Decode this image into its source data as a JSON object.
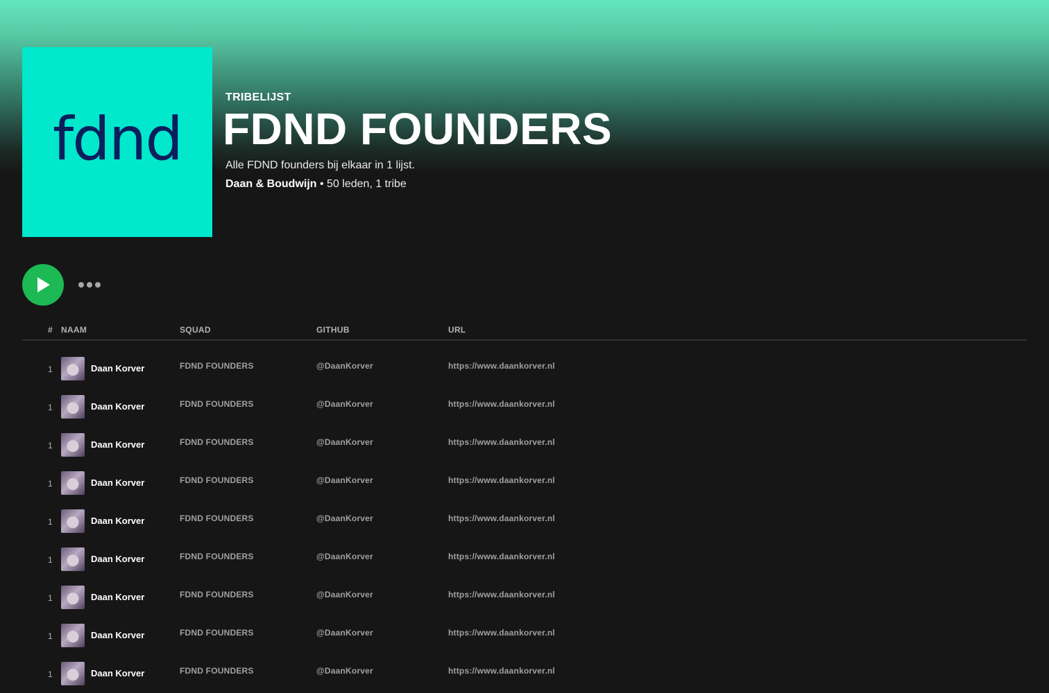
{
  "hero": {
    "cover_text": "fdnd",
    "type_label": "TRIBELIJST",
    "title": "FDND FOUNDERS",
    "description": "Alle FDND founders bij elkaar in 1 lijst.",
    "owner": "Daan & Boudwijn",
    "stats": " • 50 leden, 1 tribe",
    "colors": {
      "accent_gradient_top": "#63e6bd",
      "cover_bg": "#01e8cc",
      "cover_text": "#0b1f5c",
      "play": "#1db954",
      "background": "#161616"
    }
  },
  "controls": {
    "play_icon": "play-icon",
    "more_icon": "more-options-icon"
  },
  "table": {
    "headers": {
      "index": "#",
      "name": "NAAM",
      "squad": "SQUAD",
      "github": "GITHUB",
      "url": "URL"
    },
    "rows": [
      {
        "index": "1",
        "name": "Daan Korver",
        "squad": "FDND FOUNDERS",
        "github": "@DaanKorver",
        "url": "https://www.daankorver.nl"
      },
      {
        "index": "1",
        "name": "Daan Korver",
        "squad": "FDND FOUNDERS",
        "github": "@DaanKorver",
        "url": "https://www.daankorver.nl"
      },
      {
        "index": "1",
        "name": "Daan Korver",
        "squad": "FDND FOUNDERS",
        "github": "@DaanKorver",
        "url": "https://www.daankorver.nl"
      },
      {
        "index": "1",
        "name": "Daan Korver",
        "squad": "FDND FOUNDERS",
        "github": "@DaanKorver",
        "url": "https://www.daankorver.nl"
      },
      {
        "index": "1",
        "name": "Daan Korver",
        "squad": "FDND FOUNDERS",
        "github": "@DaanKorver",
        "url": "https://www.daankorver.nl"
      },
      {
        "index": "1",
        "name": "Daan Korver",
        "squad": "FDND FOUNDERS",
        "github": "@DaanKorver",
        "url": "https://www.daankorver.nl"
      },
      {
        "index": "1",
        "name": "Daan Korver",
        "squad": "FDND FOUNDERS",
        "github": "@DaanKorver",
        "url": "https://www.daankorver.nl"
      },
      {
        "index": "1",
        "name": "Daan Korver",
        "squad": "FDND FOUNDERS",
        "github": "@DaanKorver",
        "url": "https://www.daankorver.nl"
      },
      {
        "index": "1",
        "name": "Daan Korver",
        "squad": "FDND FOUNDERS",
        "github": "@DaanKorver",
        "url": "https://www.daankorver.nl"
      }
    ]
  }
}
